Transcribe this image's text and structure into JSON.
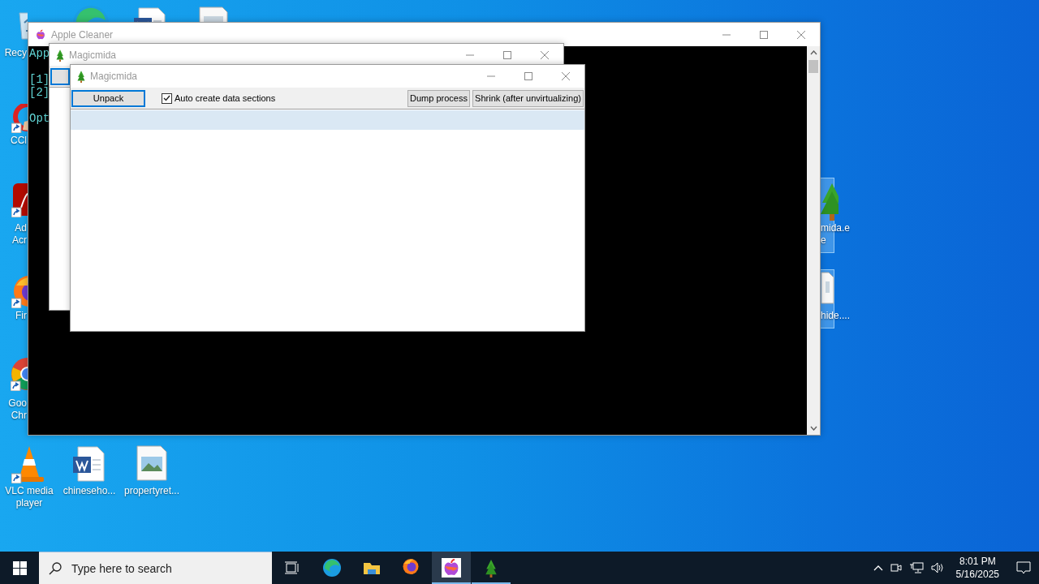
{
  "desktop": {
    "icons": [
      {
        "kind": "recycle",
        "lines": [
          "Recy"
        ],
        "selected": false
      },
      {
        "kind": "edge",
        "selected": false
      },
      {
        "kind": "word",
        "selected": false
      },
      {
        "kind": "doc",
        "selected": false
      },
      {
        "kind": "ccleaner",
        "lines": [
          "CCl"
        ],
        "selected": false
      },
      {
        "kind": "acrobat",
        "lines": [
          "Ad",
          "Acr"
        ],
        "selected": false
      },
      {
        "kind": "firefox",
        "lines": [
          "Fir"
        ],
        "selected": false
      },
      {
        "kind": "chrome",
        "lines": [
          "Goo",
          "Chr"
        ],
        "selected": false
      },
      {
        "kind": "vlc",
        "lines": [
          "VLC media",
          "player"
        ],
        "selected": false
      },
      {
        "kind": "word",
        "lines": [
          "chineseho..."
        ],
        "selected": false
      },
      {
        "kind": "image",
        "lines": [
          "propertyret..."
        ],
        "selected": false
      },
      {
        "kind": "tree",
        "lines": [
          "mida.e",
          "e"
        ],
        "selected": true
      },
      {
        "kind": "doc",
        "lines": [
          "hide...."
        ],
        "selected": true
      }
    ]
  },
  "windows": {
    "apple_cleaner": {
      "title": "Apple Cleaner",
      "console_lines": [
        {
          "text": "App"
        },
        {
          "text": "[1]"
        },
        {
          "text": "[2]"
        },
        {
          "text": "Opt"
        }
      ]
    },
    "magicmida_back": {
      "title": "Magicmida"
    },
    "magicmida": {
      "title": "Magicmida",
      "unpack_button": "Unpack",
      "auto_create": {
        "label": "Auto create data sections",
        "checked": true
      },
      "dump_button": "Dump process",
      "shrink_button": "Shrink (after unvirtualizing)",
      "list_rows": [
        {
          "selected": true
        }
      ]
    }
  },
  "taskbar": {
    "search_placeholder": "Type here to search",
    "apps": [
      {
        "kind": "edge",
        "open": false,
        "selected": false
      },
      {
        "kind": "explorer",
        "open": false,
        "selected": false
      },
      {
        "kind": "firefox",
        "open": false,
        "selected": false
      },
      {
        "kind": "apple",
        "open": true,
        "selected": true
      },
      {
        "kind": "tree",
        "open": true,
        "selected": false
      }
    ],
    "time": "8:01 PM",
    "date": "5/16/2025"
  }
}
